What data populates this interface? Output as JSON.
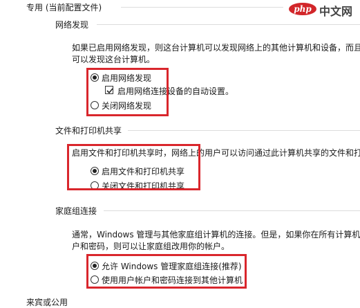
{
  "profile_header": "专用 (当前配置文件)",
  "network_discovery": {
    "heading": "网络发现",
    "description_line1": "如果已启用网络发现，则这台计算机可以发现网络上的其他计算机和设备，而且",
    "description_line2": "可以发现这台计算机。",
    "option_on": "启用网络发现",
    "auto_setup": "启用网络连接设备的自动设置。",
    "option_off": "关闭网络发现",
    "selected": "on",
    "auto_setup_checked": true
  },
  "file_printer_sharing": {
    "heading": "文件和打印机共享",
    "description": "启用文件和打印机共享时，网络上的用户可以访问通过此计算机共享的文件和打",
    "option_on": "启用文件和打印机共享",
    "option_off": "关闭文件和打印机共享",
    "selected": "on"
  },
  "homegroup": {
    "heading": "家庭组连接",
    "description_line1": "通常，Windows 管理与其他家庭组计算机的连接。但是，如果你在所有计算机",
    "description_line2": "户和密码，则可以让家庭组改用你的帐户。",
    "option_windows": "允许 Windows 管理家庭组连接(推荐)",
    "option_account": "使用用户帐户和密码连接到其他计算机",
    "selected": "windows"
  },
  "next_section_header": "来宾或公用",
  "watermark": {
    "logo": "php",
    "text": "中文网"
  },
  "colors": {
    "highlight_box": "#d9262c",
    "separator": "#dcdcdc"
  }
}
